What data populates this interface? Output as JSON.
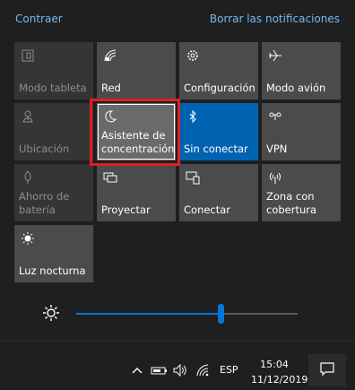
{
  "header": {
    "collapse_label": "Contraer",
    "clear_label": "Borrar las notificaciones"
  },
  "tiles": [
    {
      "label": "Modo tableta",
      "icon": "tablet-mode-icon",
      "state": "disabled"
    },
    {
      "label": "Red",
      "icon": "network-icon",
      "state": "normal"
    },
    {
      "label": "Configuración",
      "icon": "settings-gear-icon",
      "state": "normal"
    },
    {
      "label": "Modo avión",
      "icon": "airplane-icon",
      "state": "normal"
    },
    {
      "label": "Ubicación",
      "icon": "location-icon",
      "state": "disabled"
    },
    {
      "label": "Asistente de concentración",
      "icon": "moon-icon",
      "state": "selected"
    },
    {
      "label": "Sin conectar",
      "icon": "bluetooth-icon",
      "state": "on"
    },
    {
      "label": "VPN",
      "icon": "vpn-icon",
      "state": "normal"
    },
    {
      "label": "Ahorro de batería",
      "icon": "battery-saver-icon",
      "state": "disabled"
    },
    {
      "label": "Proyectar",
      "icon": "project-icon",
      "state": "normal"
    },
    {
      "label": "Conectar",
      "icon": "connect-icon",
      "state": "normal"
    },
    {
      "label": "Zona con cobertura",
      "icon": "mobile-hotspot-icon",
      "state": "normal"
    },
    {
      "label": "Luz nocturna",
      "icon": "night-light-icon",
      "state": "normal"
    }
  ],
  "brightness": {
    "icon": "brightness-icon",
    "level": 0.65,
    "accent_color": "#0078d7"
  },
  "taskbar": {
    "icons": [
      "show-hidden-icons-chevron",
      "power-battery-icon",
      "volume-icon",
      "wifi-icon"
    ],
    "language": "ESP",
    "time": "15:04",
    "date": "11/12/2019",
    "notification_icon": "action-center-icon"
  },
  "colors": {
    "accent": "#0063b1",
    "link": "#79b8ec",
    "highlight_border": "#e21d27"
  }
}
